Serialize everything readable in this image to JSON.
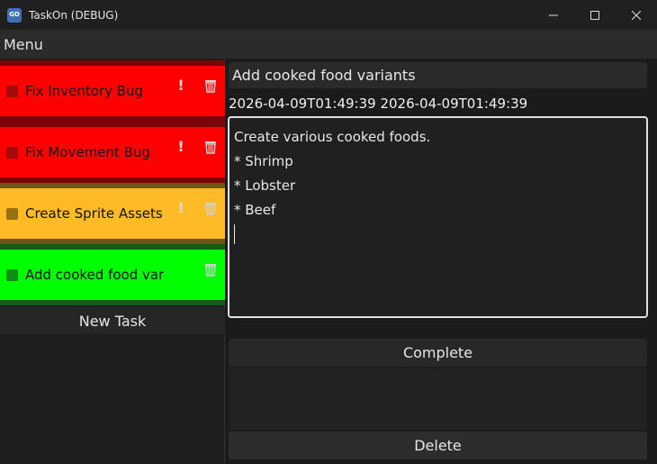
{
  "window": {
    "title": "TaskOn (DEBUG)",
    "controls": [
      "minimize-icon",
      "maximize-icon",
      "close-icon"
    ]
  },
  "menu": {
    "label": "Menu"
  },
  "tasks": [
    {
      "name": "Fix Inventory Bug",
      "priority": "!",
      "color": "#ff0000"
    },
    {
      "name": "Fix Movement Bug",
      "priority": "!",
      "color": "#ff0000"
    },
    {
      "name": "Create Sprite Assets",
      "priority": "!",
      "color": "#ffbb25"
    },
    {
      "name": "Add cooked food variants",
      "priority": "",
      "color": "#00ff00"
    }
  ],
  "sidebar": {
    "new_task_label": "New Task"
  },
  "detail": {
    "title": "Add cooked food variants",
    "timestamps": "2026-04-09T01:49:39 2026-04-09T01:49:39",
    "notes": [
      "Create various cooked foods.",
      "* Shrimp",
      "* Lobster",
      "* Beef"
    ],
    "complete_label": "Complete",
    "delete_label": "Delete"
  }
}
